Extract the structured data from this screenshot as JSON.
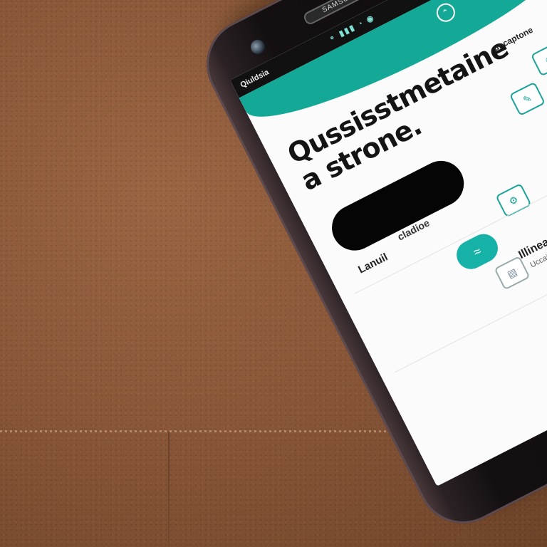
{
  "scene": {
    "surface": "brown leather desk pad",
    "colors": {
      "leather": "#8a5838",
      "teal": "#14a896",
      "phone_body": "#0e0c0d"
    }
  },
  "phone": {
    "earpiece_label": "SAMSUNG",
    "status_bar": {
      "carrier": "Qiuldsia",
      "icons": "⚬ ▮▮▮ ◔ ◉"
    },
    "header_icon": "chevron-up-icon",
    "headline_line1": "Qussisstmetaine",
    "headline_line2": "a strone.",
    "top_right_label": "uncaptone",
    "label_small": "Lanuil",
    "label_mid": "cladioe",
    "row_title": "Illinearer L",
    "row_sub": "Uccai tu cn",
    "icons": [
      "robot-icon",
      "pen-icon",
      "gear-icon",
      "bag-icon",
      "toggle-icon",
      "doc-icon"
    ]
  }
}
